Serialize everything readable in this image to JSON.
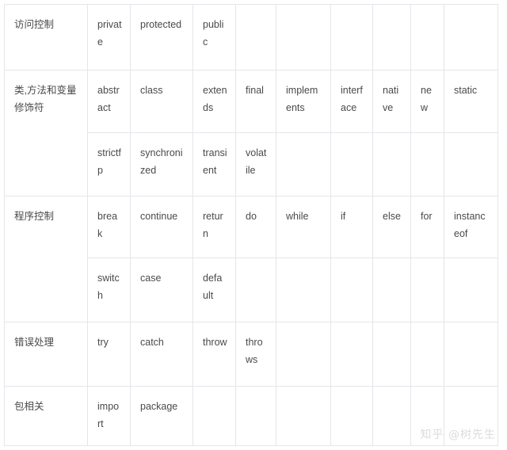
{
  "table": {
    "name": "java-keywords-table",
    "categories": [
      {
        "label": "访问控制",
        "rowspan": 1
      },
      {
        "label": "类,方法和变量修饰符",
        "rowspan": 2
      },
      {
        "label": "程序控制",
        "rowspan": 2
      },
      {
        "label": "错误处理",
        "rowspan": 1
      },
      {
        "label": "包相关",
        "rowspan": 1
      }
    ],
    "rows": [
      {
        "category": "访问控制",
        "keywords": [
          "private",
          "protected",
          "public",
          "",
          "",
          "",
          "",
          "",
          ""
        ]
      },
      {
        "category": "类,方法和变量修饰符",
        "keywords": [
          "abstract",
          "class",
          "extends",
          "final",
          "implements",
          "interface",
          "native",
          "new",
          "static"
        ]
      },
      {
        "category": "",
        "keywords": [
          "strictfp",
          "synchronized",
          "transient",
          "volatile",
          "",
          "",
          "",
          "",
          ""
        ]
      },
      {
        "category": "程序控制",
        "keywords": [
          "break",
          "continue",
          "return",
          "do",
          "while",
          "if",
          "else",
          "for",
          "instanceof"
        ]
      },
      {
        "category": "",
        "keywords": [
          "switch",
          "case",
          "default",
          "",
          "",
          "",
          "",
          "",
          ""
        ]
      },
      {
        "category": "错误处理",
        "keywords": [
          "try",
          "catch",
          "throw",
          "throws",
          "",
          "",
          "",
          "",
          ""
        ]
      },
      {
        "category": "包相关",
        "keywords": [
          "import",
          "package",
          "",
          "",
          "",
          "",
          "",
          "",
          ""
        ]
      }
    ]
  },
  "watermark": {
    "text": "知乎 @树先生"
  },
  "colors": {
    "border": "#e3e6ea",
    "text": "#555a60",
    "category_text": "#3d3d3d",
    "watermark": "#d9dcdf",
    "background": "#ffffff"
  }
}
